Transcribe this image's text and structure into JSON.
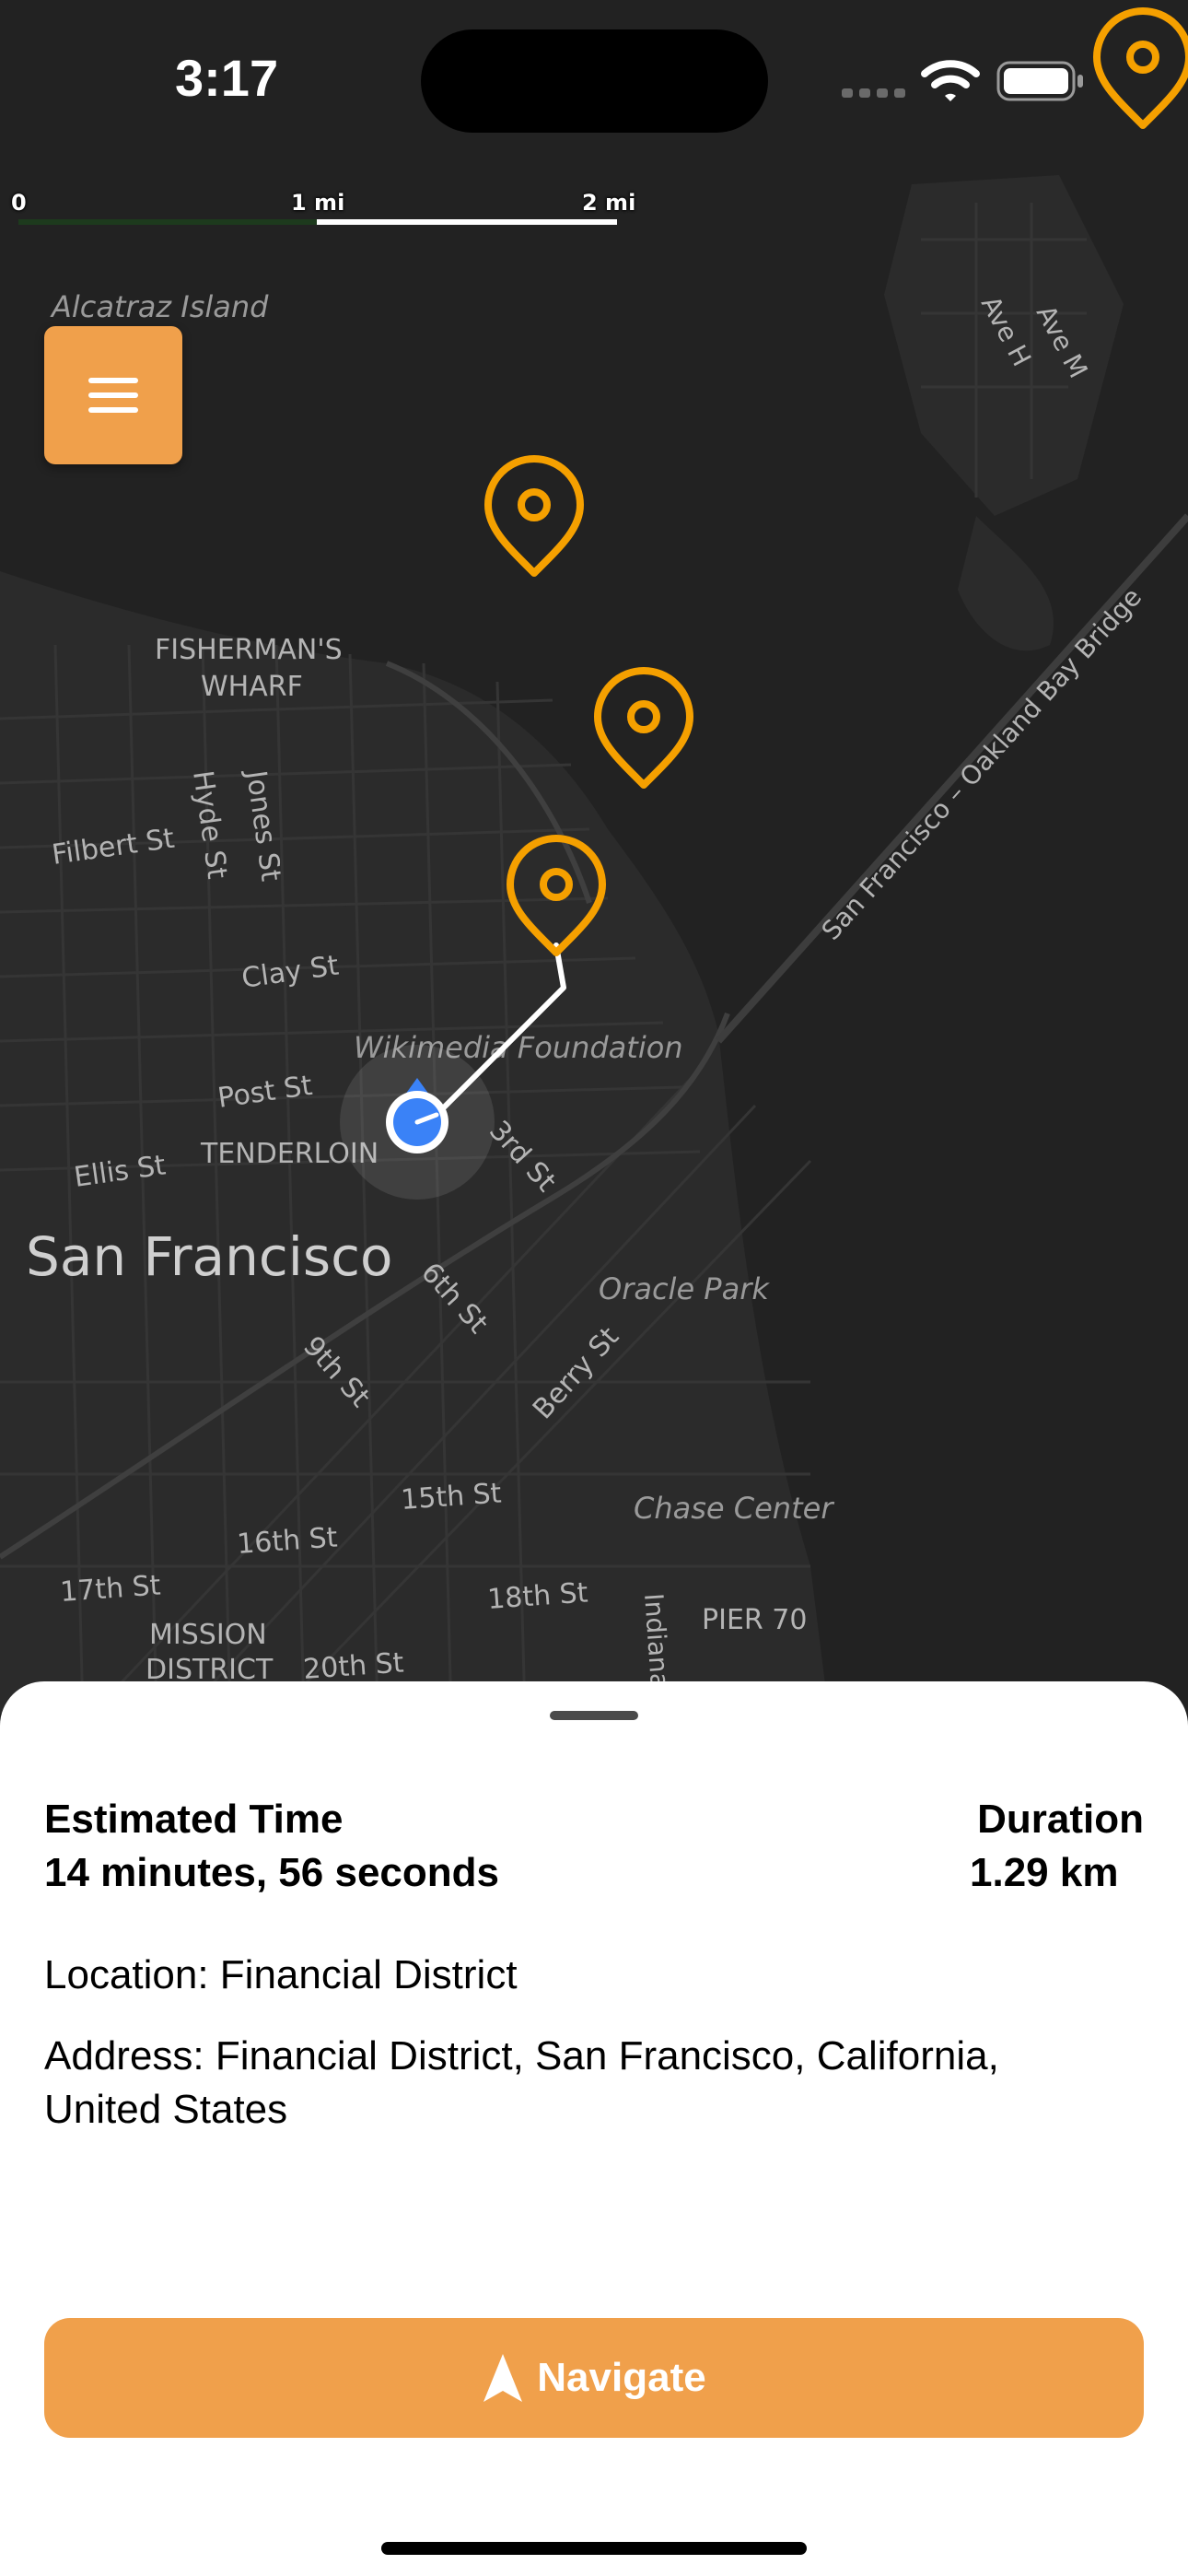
{
  "status_bar": {
    "time": "3:17"
  },
  "map": {
    "scale": {
      "labels": [
        "0",
        "1 mi",
        "2 mi"
      ]
    },
    "labels": {
      "alcatraz": "Alcatraz Island",
      "fishermans_wharf_1": "FISHERMAN'S",
      "fishermans_wharf_2": "WHARF",
      "ave_h": "Ave H",
      "ave_m": "Ave M",
      "bay_bridge": "San Francisco – Oakland Bay Bridge",
      "filbert": "Filbert St",
      "hyde": "Hyde St",
      "jones": "Jones St",
      "clay": "Clay St",
      "wikimedia": "Wikimedia Foundation",
      "post": "Post St",
      "tenderloin": "TENDERLOIN",
      "ellis": "Ellis St",
      "third": "3rd St",
      "city": "San Francisco",
      "sixth": "6th St",
      "oracle": "Oracle Park",
      "ninth": "9th St",
      "berry": "Berry St",
      "fifteenth": "15th St",
      "chase": "Chase Center",
      "sixteenth": "16th St",
      "seventeenth": "17th St",
      "eighteenth": "18th St",
      "indiana": "Indiana",
      "pier70": "PIER 70",
      "mission_1": "MISSION",
      "mission_2": "DISTRICT",
      "twentieth": "20th St"
    },
    "pin_color": "#f5a000",
    "route_color": "#ffffff",
    "user_location_color": "#3a82f7"
  },
  "menu_button": {
    "icon": "hamburger-icon",
    "color": "#f0a04b"
  },
  "sheet": {
    "estimated_time_title": "Estimated Time",
    "estimated_time_value": "14 minutes, 56 seconds",
    "duration_title": "Duration",
    "duration_value": "1.29 km",
    "location": "Location: Financial District",
    "address_line1": "Address: Financial District, San Francisco, California,",
    "address_line2": "United States",
    "navigate_label": "Navigate",
    "navigate_icon": "navigation-arrow-icon",
    "accent_color": "#f0a04b"
  }
}
